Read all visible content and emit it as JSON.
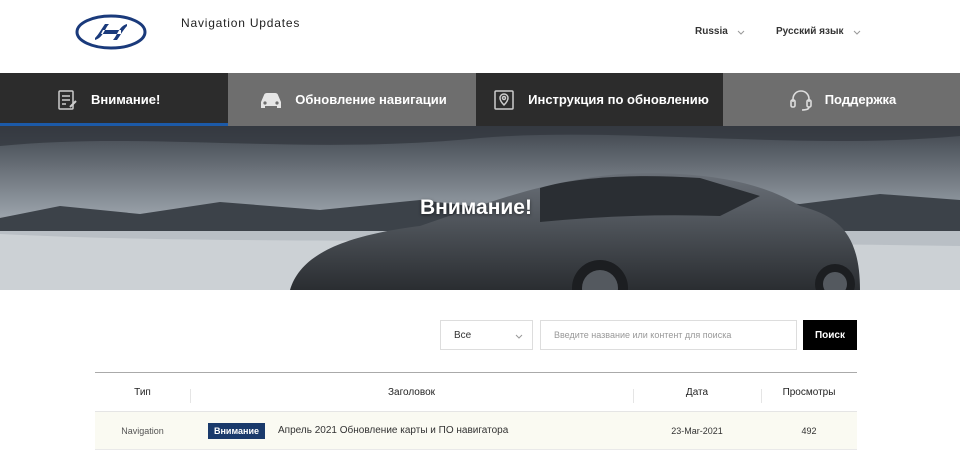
{
  "header": {
    "site_title": "Navigation Updates",
    "country": "Russia",
    "language": "Русский язык"
  },
  "tabs": [
    {
      "label": "Внимание!",
      "icon": "document-icon",
      "active": true
    },
    {
      "label": "Обновление навигации",
      "icon": "car-icon",
      "active": false
    },
    {
      "label": "Инструкция по обновлению",
      "icon": "map-pin-icon",
      "active": false
    },
    {
      "label": "Поддержка",
      "icon": "headset-icon",
      "active": false
    }
  ],
  "hero": {
    "title": "Внимание!"
  },
  "search": {
    "category": "Все",
    "placeholder": "Введите название или контент для поиска",
    "button": "Поиск"
  },
  "table": {
    "headers": {
      "type": "Тип",
      "title": "Заголовок",
      "date": "Дата",
      "views": "Просмотры"
    },
    "rows": [
      {
        "type": "Navigation",
        "badge": "Внимание",
        "title": "Апрель 2021 Обновление карты и ПО навигатора",
        "date": "23-Mar-2021",
        "views": "492"
      }
    ]
  },
  "colors": {
    "brand": "#1c5aa8",
    "badge": "#1a3a6b",
    "tab_dark": "#2c2c2c",
    "tab_gray": "#6e6e6e"
  }
}
